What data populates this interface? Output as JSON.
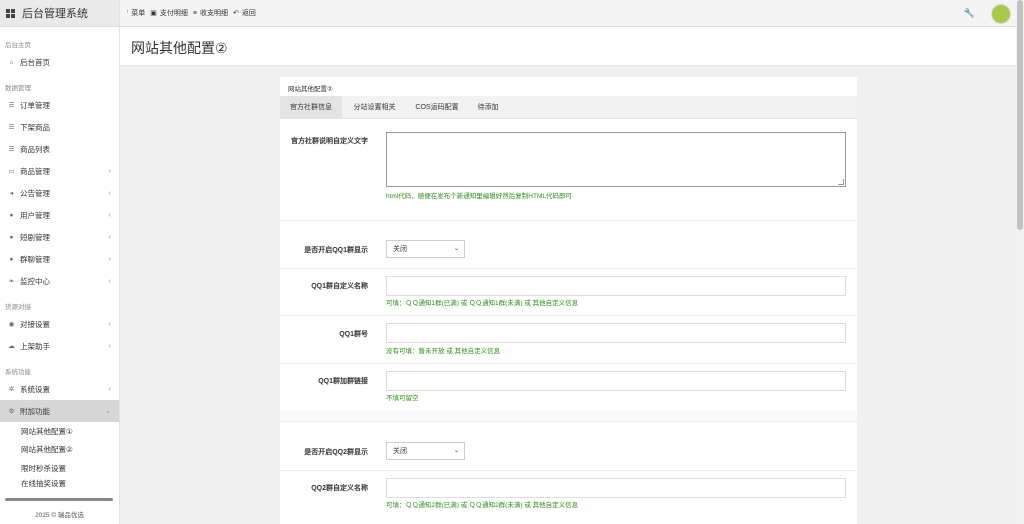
{
  "brand": {
    "title": "后台管理系统"
  },
  "topbar": {
    "items": [
      {
        "icon": "ⁱ",
        "label": "菜单"
      },
      {
        "icon": "▣",
        "label": "支付明细"
      },
      {
        "icon": "≡",
        "label": "收支明细"
      },
      {
        "icon": "↶",
        "label": "返回"
      }
    ],
    "wrench": "🔧"
  },
  "sidebar": {
    "sec_home": "后台主页",
    "home": "后台首页",
    "sec_data": "数据管理",
    "orders": "订单管理",
    "offline": "下架商品",
    "goods_list": "商品列表",
    "goods_mgmt": "商品管理",
    "notice": "公告管理",
    "users": "用户管理",
    "drama": "短剧管理",
    "group": "群聊管理",
    "monitor": "监控中心",
    "sec_dock": "货源对接",
    "dock_set": "对接设置",
    "listing": "上架助手",
    "sec_sys": "系统功能",
    "sys_set": "系统设置",
    "addon": "附加功能",
    "sub1": "网站其他配置①",
    "sub2": "网站其他配置②",
    "sub3": "限时秒杀设置",
    "sub4": "在线抽奖设置",
    "copyright": "2025 © 瑞品优选"
  },
  "page": {
    "title": "网站其他配置②"
  },
  "card": {
    "title": "网站其他配置②",
    "tabs": [
      "官方社群信息",
      "分站设置相关",
      "COS运码配置",
      "待添加"
    ],
    "fields": {
      "desc_label": "官方社群说明自定义文字",
      "desc_hint": "html代码，随便在发布个新通知里编辑好然后复制HTML代码即可",
      "qq1_show_label": "是否开启QQ1群显示",
      "qq1_show_value": "关闭",
      "qq1_name_label": "QQ1群自定义名称",
      "qq1_name_hint": "可填：ＱＱ通知1群(已满) 或 ＱＱ通知1群(未满) 或 其他自定义信息",
      "qq1_num_label": "QQ1群号",
      "qq1_num_hint": "没有可填：暂未开放 或 其他自定义信息",
      "qq1_link_label": "QQ1群加群链接",
      "qq1_link_hint": "不填可留空",
      "qq2_show_label": "是否开启QQ2群显示",
      "qq2_show_value": "关闭",
      "qq2_name_label": "QQ2群自定义名称",
      "qq2_name_hint": "可填：ＱＱ通知2群(已满) 或 ＱＱ通知2群(未满) 或 其他自定义信息"
    }
  }
}
